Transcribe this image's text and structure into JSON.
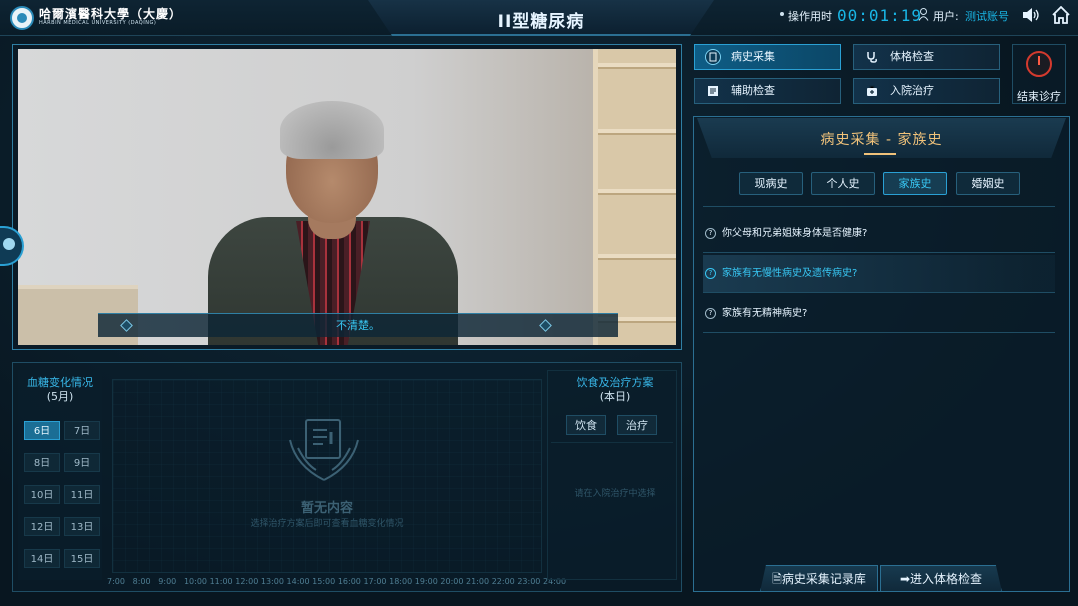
{
  "header": {
    "university_cn": "哈爾濱醫科大學（大慶）",
    "university_en": "HARBIN MEDICAL UNIVERSITY   (DAQING)",
    "title": "II型糖尿病",
    "timer_label": "操作用时",
    "timer_value": "00:01:19",
    "user_label": "用户:",
    "user_name": "测试账号"
  },
  "video": {
    "subtitle": "不清楚。"
  },
  "blood_sugar": {
    "title": "血糖变化情况",
    "month": "(5月)",
    "dates": [
      "6日",
      "7日",
      "8日",
      "9日",
      "10日",
      "11日",
      "12日",
      "13日",
      "14日",
      "15日"
    ],
    "active_date": "6日",
    "empty_title": "暂无内容",
    "empty_sub": "选择治疗方案后即可查看血糖变化情况",
    "time_ticks": [
      "7:00",
      "8:00",
      "9:00",
      "10:00",
      "11:00",
      "12:00",
      "13:00",
      "14:00",
      "15:00",
      "16:00",
      "17:00",
      "18:00",
      "19:00",
      "20:00",
      "21:00",
      "22:00",
      "23:00",
      "24:00"
    ]
  },
  "diet": {
    "title": "饮食及治疗方案",
    "subtitle": "(本日)",
    "tab_diet": "饮食",
    "tab_treat": "治疗",
    "note": "请在入院治疗中选择"
  },
  "menu": {
    "history": "病史采集",
    "physical": "体格检查",
    "auxiliary": "辅助检查",
    "admission": "入院治疗",
    "end": "结束诊疗"
  },
  "history_panel": {
    "title": "病史采集 - 家族史",
    "tabs": [
      "现病史",
      "个人史",
      "家族史",
      "婚姻史"
    ],
    "active_tab": "家族史",
    "questions": [
      "你父母和兄弟姐妹身体是否健康?",
      "家族有无慢性病史及遗传病史?",
      "家族有无精神病史?"
    ],
    "active_question_index": 1,
    "btn_records": "病史采集记录库",
    "btn_next": "进入体格检查"
  }
}
